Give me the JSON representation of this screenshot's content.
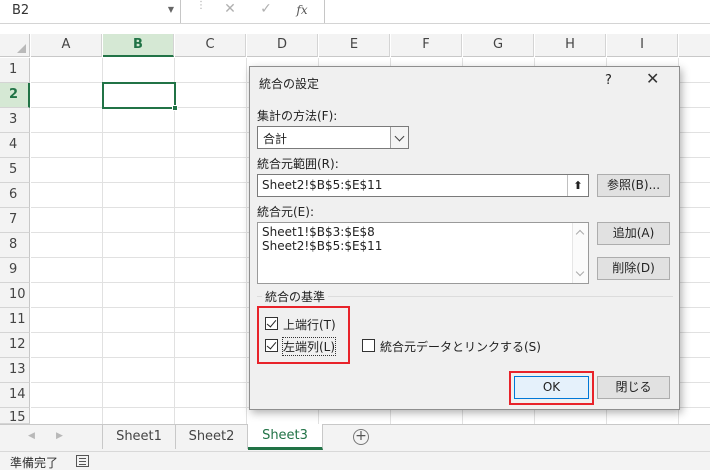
{
  "formula_bar": {
    "name_box": "B2",
    "cancel_icon": "✕",
    "enter_icon": "✓",
    "fx_label": "fx",
    "formula": ""
  },
  "columns": [
    "A",
    "B",
    "C",
    "D",
    "E",
    "F",
    "G",
    "H",
    "I"
  ],
  "rows": [
    "1",
    "2",
    "3",
    "4",
    "5",
    "6",
    "7",
    "8",
    "9",
    "10",
    "11",
    "12",
    "13",
    "14",
    "15"
  ],
  "selected": {
    "cell": "B2",
    "column": "B",
    "row": "2"
  },
  "sheet_tabs": {
    "tabs": [
      "Sheet1",
      "Sheet2",
      "Sheet3"
    ],
    "active": "Sheet3",
    "add_icon": "+"
  },
  "status_bar": {
    "text": "準備完了"
  },
  "dialog": {
    "title": "統合の設定",
    "help": "?",
    "close": "✕",
    "function_label": "集計の方法(F):",
    "function_value": "合計",
    "reference_label": "統合元範囲(R):",
    "reference_value": "Sheet2!$B$5:$E$11",
    "pick_icon": "⬆",
    "browse_button": "参照(B)...",
    "all_refs_label": "統合元(E):",
    "all_refs": [
      "Sheet1!$B$3:$E$8",
      "Sheet2!$B$5:$E$11"
    ],
    "add_button": "追加(A)",
    "delete_button": "削除(D)",
    "labels_group": "統合の基準",
    "top_row": {
      "label": "上端行(T)",
      "checked": true
    },
    "left_column": {
      "label": "左端列(L)",
      "checked": true
    },
    "link_source": {
      "label": "統合元データとリンクする(S)",
      "checked": false
    },
    "ok_button": "OK",
    "close_button": "閉じる"
  },
  "colors": {
    "accent": "#217346",
    "highlight": "#e8232a",
    "default_button": "#0078d7"
  }
}
